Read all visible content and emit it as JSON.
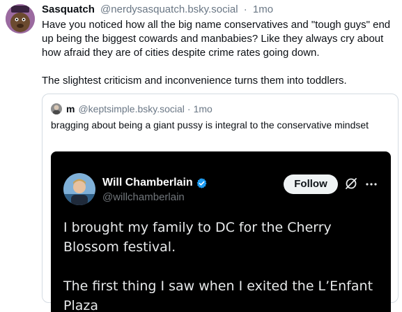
{
  "post": {
    "author_name": "Sasquatch",
    "author_handle": "@nerdysasquatch.bsky.social",
    "separator": "·",
    "time": "1mo",
    "paragraphs": [
      "Have you noticed how all the big name conservatives and \"tough guys\" end up being the biggest cowards and manbabies? Like they always cry about how afraid they are of cities despite crime rates going down.",
      "The slightest criticism and inconvenience turns them into toddlers."
    ]
  },
  "quote": {
    "author_name": "m",
    "author_handle": "@keptsimple.bsky.social",
    "separator": "·",
    "time": "1mo",
    "text": "bragging about being a giant pussy is integral to the conservative mindset"
  },
  "embed": {
    "author_name": "Will Chamberlain",
    "author_handle": "@willchamberlain",
    "follow_label": "Follow",
    "paragraphs": [
      "I brought my family to DC for the Cherry Blossom festival.",
      "The first thing I saw when I exited the L’Enfant Plaza"
    ]
  },
  "colors": {
    "text_primary": "#0b0f14",
    "text_secondary": "#6a7785",
    "quote_border": "#d4dbe2",
    "embed_background": "#000000",
    "verified_blue": "#1d9bf0",
    "follow_button_bg": "#eff3f4"
  },
  "icons": {
    "verified": "verified-badge-icon",
    "grok": "grok-icon",
    "more": "more-options-icon"
  }
}
